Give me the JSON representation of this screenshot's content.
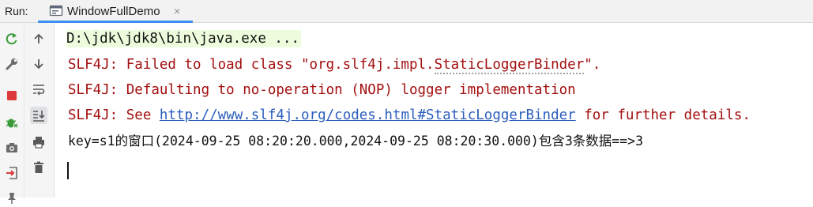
{
  "run_panel": {
    "label": "Run:",
    "tab": {
      "label": "WindowFullDemo",
      "close": "×"
    }
  },
  "toolbar_left": [
    {
      "icon": "rerun-icon",
      "color": "#3a9a3a"
    },
    {
      "icon": "wrench-icon",
      "color": "#6b6b6b"
    },
    {
      "icon": "stop-icon",
      "color": "#db3b3b"
    },
    {
      "icon": "debug-bug-icon",
      "color": "#3a9a3a"
    },
    {
      "icon": "camera-icon",
      "color": "#6b6b6b"
    },
    {
      "icon": "login-icon",
      "color": "#db3b3b"
    },
    {
      "icon": "pin-icon",
      "color": "#6b6b6b"
    }
  ],
  "toolbar_right": [
    {
      "icon": "arrow-up-icon"
    },
    {
      "icon": "arrow-down-icon"
    },
    {
      "icon": "soft-wrap-icon"
    },
    {
      "icon": "scroll-to-end-icon"
    },
    {
      "icon": "print-icon"
    },
    {
      "icon": "trash-icon"
    }
  ],
  "console": {
    "command": "D:\\jdk\\jdk8\\bin\\java.exe ...",
    "err1_prefix": "SLF4J: Failed to load class \"org.slf4j.impl.",
    "err1_class": "StaticLoggerBinder",
    "err1_suffix": "\".",
    "err2": "SLF4J: Defaulting to no-operation (NOP) logger implementation",
    "err3_prefix": "SLF4J: See ",
    "err3_link": "http://www.slf4j.org/codes.html#StaticLoggerBinder",
    "err3_suffix": " for further details.",
    "output": "key=s1的窗口(2024-09-25 08:20:20.000,2024-09-25 08:20:30.000)包含3条数据==>3"
  }
}
